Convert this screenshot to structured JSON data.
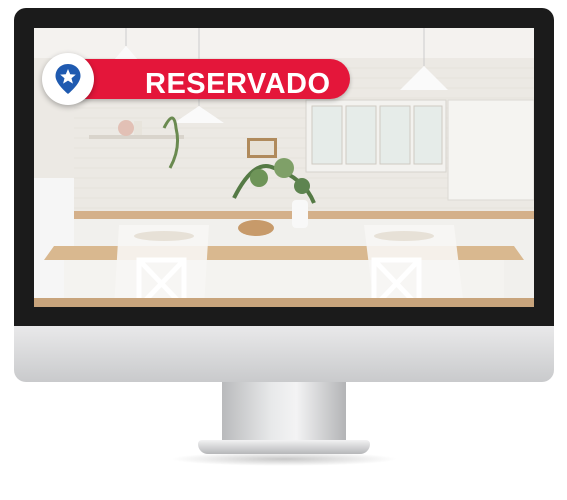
{
  "badge": {
    "label": "RESERVADO",
    "icon": "star-pin-icon",
    "pill_color": "#e4163a",
    "pin_color": "#1f5ab0"
  },
  "screen": {
    "image": "kitchen-photo"
  }
}
